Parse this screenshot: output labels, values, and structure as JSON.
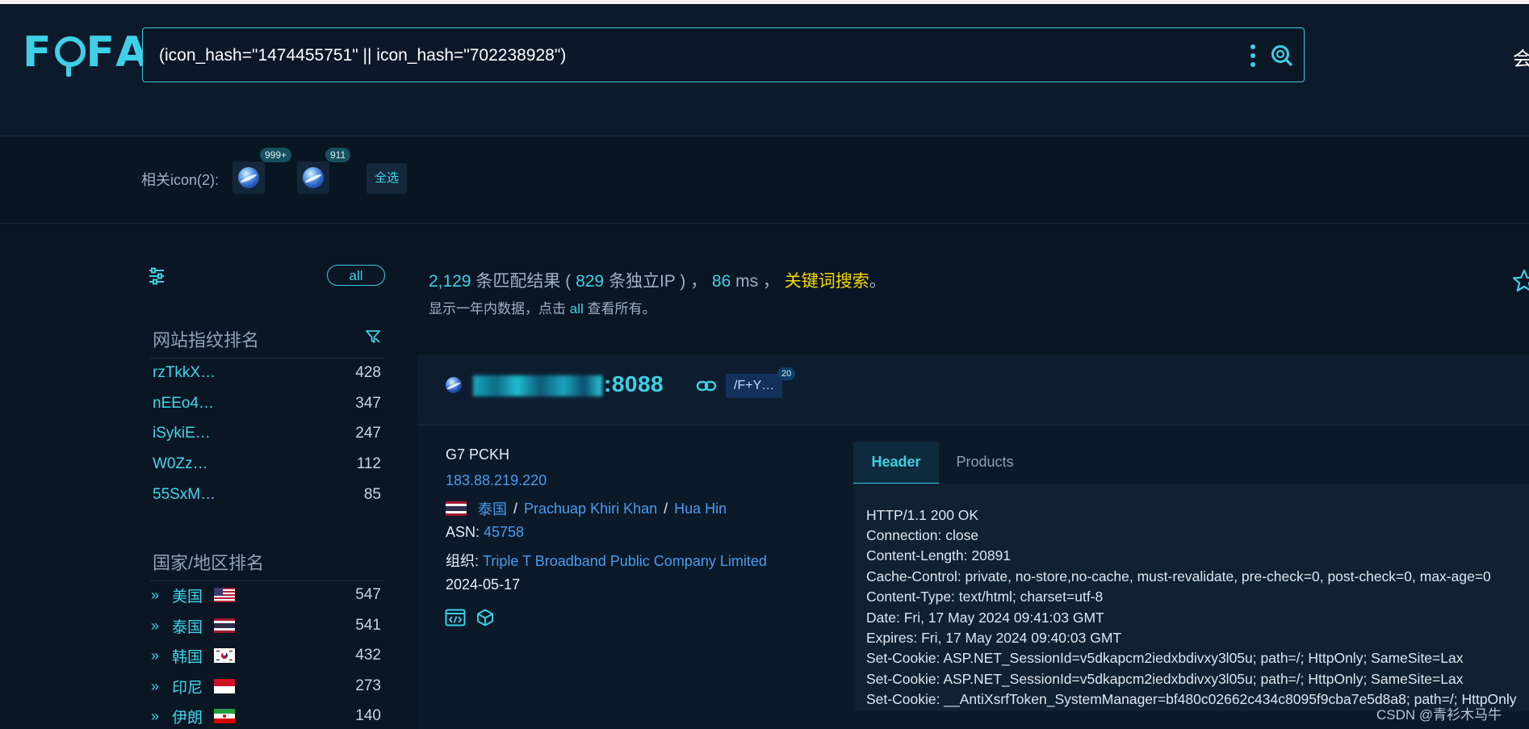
{
  "app": {
    "logo_text": [
      "F",
      "F",
      "A"
    ],
    "logo_alt": "FOFA"
  },
  "search": {
    "query": "(icon_hash=\"1474455751\" || icon_hash=\"702238928\")"
  },
  "topright_char": "会",
  "related_icons": {
    "label": "相关icon(2):",
    "icons": [
      {
        "count": "999+"
      },
      {
        "count": "911"
      }
    ],
    "select_all": "全选"
  },
  "sidebar": {
    "all_label": "all",
    "fingerprint_title": "网站指纹排名",
    "fingerprints": [
      {
        "name": "rzTkkX…",
        "count": "428"
      },
      {
        "name": "nEEo4…",
        "count": "347"
      },
      {
        "name": "iSykiE…",
        "count": "247"
      },
      {
        "name": "W0Zz…",
        "count": "112"
      },
      {
        "name": "55SxM…",
        "count": "85"
      }
    ],
    "country_title": "国家/地区排名",
    "countries": [
      {
        "name": "美国",
        "flag": "us",
        "count": "547"
      },
      {
        "name": "泰国",
        "flag": "th",
        "count": "541"
      },
      {
        "name": "韩国",
        "flag": "kr",
        "count": "432"
      },
      {
        "name": "印尼",
        "flag": "id",
        "count": "273"
      },
      {
        "name": "伊朗",
        "flag": "ir",
        "count": "140"
      }
    ]
  },
  "stats": {
    "total": "2,129",
    "text1": " 条匹配结果 ( ",
    "ips": "829",
    "text2": " 条独立IP ) ， ",
    "ms": "86",
    "text3": " ms ， ",
    "keyword": "关键词搜索",
    "text4": "。",
    "note_prefix": "显示一年内数据，点击 ",
    "note_all": "all",
    "note_suffix": " 查看所有。"
  },
  "result": {
    "port_suffix": ":8088",
    "path_badge": "/F+Y…",
    "path_count": "20",
    "title": "G7 PCKH",
    "ip": "183.88.219.220",
    "country": "泰国",
    "region": "Prachuap Khiri Khan",
    "city": "Hua Hin",
    "sep": "/",
    "asn_label": "ASN: ",
    "asn": "45758",
    "org_label": "组织: ",
    "org": "Triple T Broadband Public Company Limited",
    "date": "2024-05-17",
    "tabs": {
      "header": "Header",
      "products": "Products"
    },
    "header_lines": [
      "HTTP/1.1 200 OK",
      "Connection: close",
      "Content-Length: 20891",
      "Cache-Control: private, no-store,no-cache, must-revalidate, pre-check=0, post-check=0, max-age=0",
      "Content-Type: text/html; charset=utf-8",
      "Date: Fri, 17 May 2024 09:41:03 GMT",
      "Expires: Fri, 17 May 2024 09:40:03 GMT",
      "Set-Cookie: ASP.NET_SessionId=v5dkapcm2iedxbdivxy3l05u; path=/; HttpOnly; SameSite=Lax",
      "Set-Cookie: ASP.NET_SessionId=v5dkapcm2iedxbdivxy3l05u; path=/; HttpOnly; SameSite=Lax",
      "Set-Cookie: __AntiXsrfToken_SystemManager=bf480c02662c434c8095f9cba7e5d8a8; path=/; HttpOnly"
    ]
  },
  "watermark": "CSDN @青衫木马牛",
  "colors": {
    "accent": "#3ed0e6",
    "link": "#4a9cf0",
    "keyword": "#f5d800",
    "background": "#0b1624"
  }
}
